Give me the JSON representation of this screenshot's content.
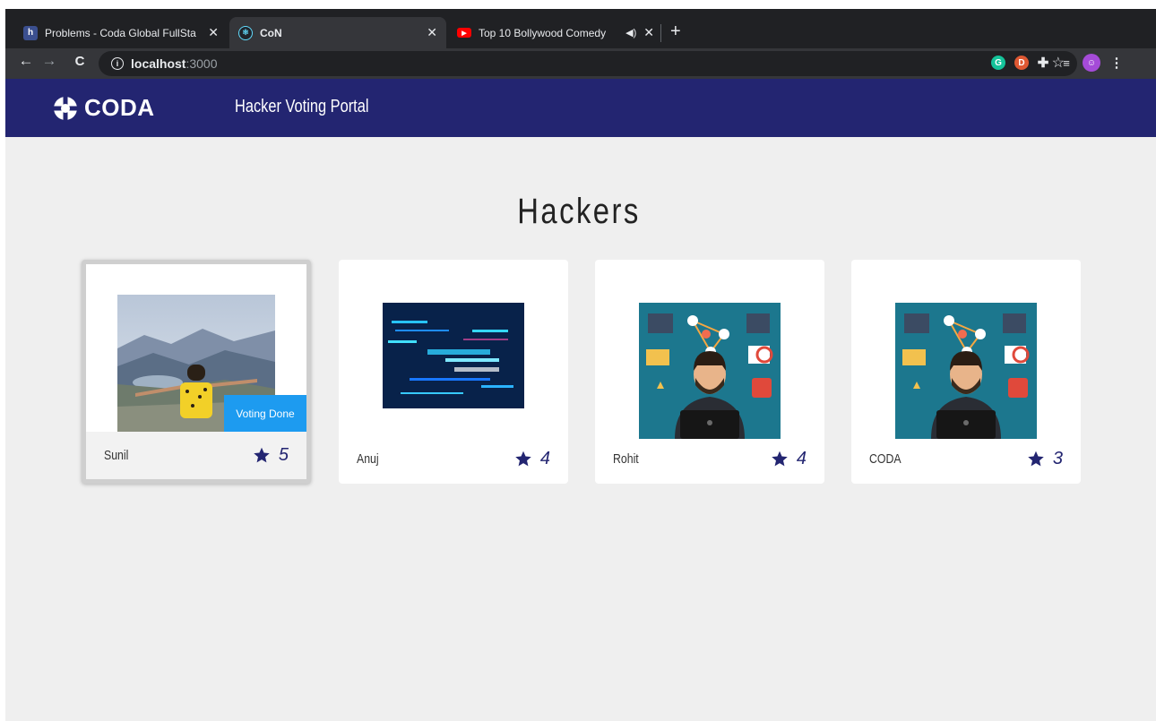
{
  "browser": {
    "tabs": [
      {
        "title": "Problems - Coda Global FullSta",
        "favicon": "hackerearth-icon"
      },
      {
        "title": "CoN",
        "favicon": "react-icon",
        "active": true
      },
      {
        "title": "Top 10 Bollywood Comedy",
        "favicon": "youtube-icon",
        "audio": true
      }
    ],
    "url_host": "localhost",
    "url_port": ":3000"
  },
  "header": {
    "brand": "CODA",
    "title": "Hacker Voting Portal",
    "bg_color": "#232571"
  },
  "page": {
    "heading": "Hackers"
  },
  "hackers": [
    {
      "name": "Sunil",
      "votes": "5",
      "badge": "Voting Done",
      "selected": true,
      "image": "landscape-photo"
    },
    {
      "name": "Anuj",
      "votes": "4",
      "image": "code-screen"
    },
    {
      "name": "Rohit",
      "votes": "4",
      "image": "hacker-illustration"
    },
    {
      "name": "CODA",
      "votes": "3",
      "image": "hacker-illustration"
    }
  ],
  "colors": {
    "accent": "#232571",
    "badge": "#1d9bf0",
    "page_bg": "#efefef"
  }
}
